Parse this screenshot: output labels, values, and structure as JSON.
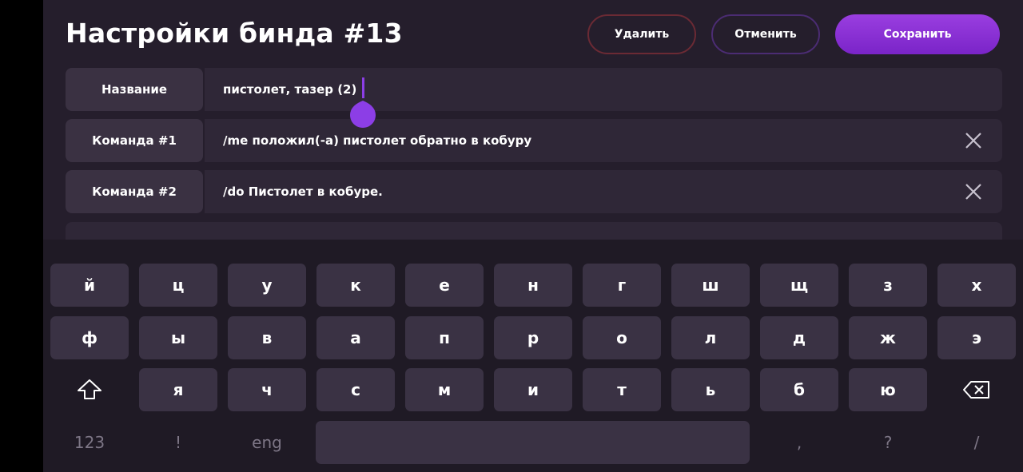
{
  "header": {
    "title": "Настройки бинда #13",
    "delete_label": "Удалить",
    "cancel_label": "Отменить",
    "save_label": "Сохранить"
  },
  "fields": [
    {
      "label": "Название",
      "value": "пистолет, тазер (2)"
    },
    {
      "label": "Команда #1",
      "value": "/me положил(-а) пистолет обратно в кобуру"
    },
    {
      "label": "Команда #2",
      "value": "/do Пистолет в кобуре."
    }
  ],
  "keyboard": {
    "row1": [
      "й",
      "ц",
      "у",
      "к",
      "е",
      "н",
      "г",
      "ш",
      "щ",
      "з",
      "х"
    ],
    "row2": [
      "ф",
      "ы",
      "в",
      "а",
      "п",
      "р",
      "о",
      "л",
      "д",
      "ж",
      "э"
    ],
    "row3": [
      "я",
      "ч",
      "с",
      "м",
      "и",
      "т",
      "ь",
      "б",
      "ю"
    ],
    "row4_left": [
      "123",
      "!",
      "eng"
    ],
    "row4_right": [
      ",",
      "?",
      "/"
    ]
  },
  "colors": {
    "accent": "#8c3ee6",
    "delete_border": "#6b2a34",
    "background": "#251e2c"
  }
}
